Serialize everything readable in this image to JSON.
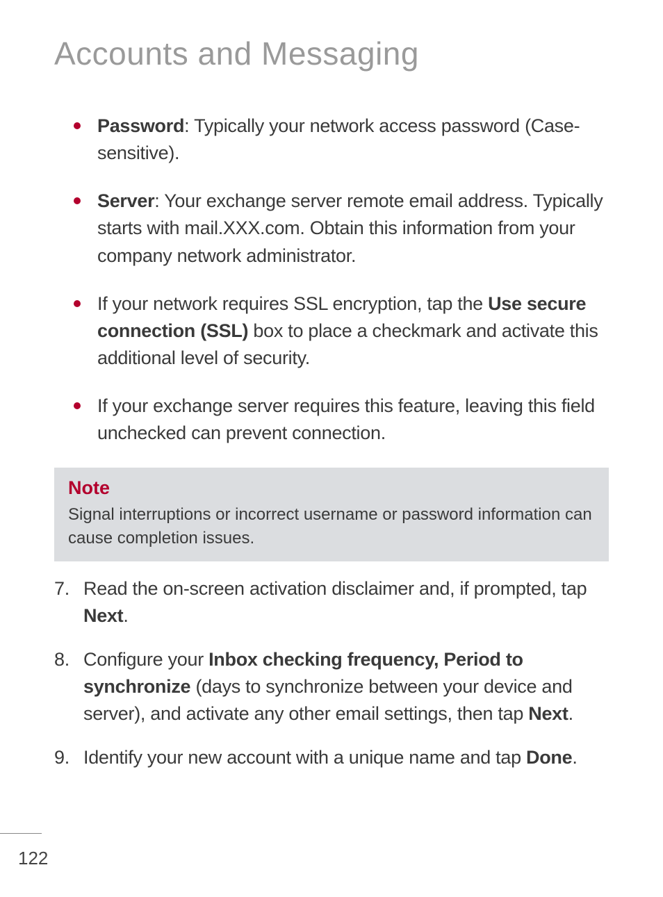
{
  "heading": "Accounts and Messaging",
  "bullets": [
    {
      "label": "Password",
      "label_sep": ": ",
      "text": "Typically your network access password (Case-sensitive)."
    },
    {
      "label": "Server",
      "label_sep": ": ",
      "text": "Your exchange server remote email address. Typically starts with mail.XXX.com. Obtain this information from your company network administrator."
    },
    {
      "pre": "If your network requires SSL encryption, tap the ",
      "bold": "Use secure connection (SSL)",
      "post": " box to place a checkmark and activate this additional level of security."
    },
    {
      "text": "If your exchange server requires this feature, leaving this field unchecked can prevent connection."
    }
  ],
  "note": {
    "title": "Note",
    "text": "Signal interruptions or incorrect username or password information can cause completion issues."
  },
  "steps": [
    {
      "num": "7.",
      "pre": "Read the on-screen activation disclaimer and, if prompted, tap ",
      "bold": "Next",
      "post": "."
    },
    {
      "num": "8.",
      "pre": "Configure your ",
      "bold": "Inbox checking frequency, Period to synchronize",
      "mid": " (days to synchronize between your device and server), and activate any other email settings, then tap ",
      "bold2": "Next",
      "post": "."
    },
    {
      "num": "9.",
      "pre": "Identify your new account with a unique name and tap ",
      "bold": "Done",
      "post": "."
    }
  ],
  "page_number": "122"
}
